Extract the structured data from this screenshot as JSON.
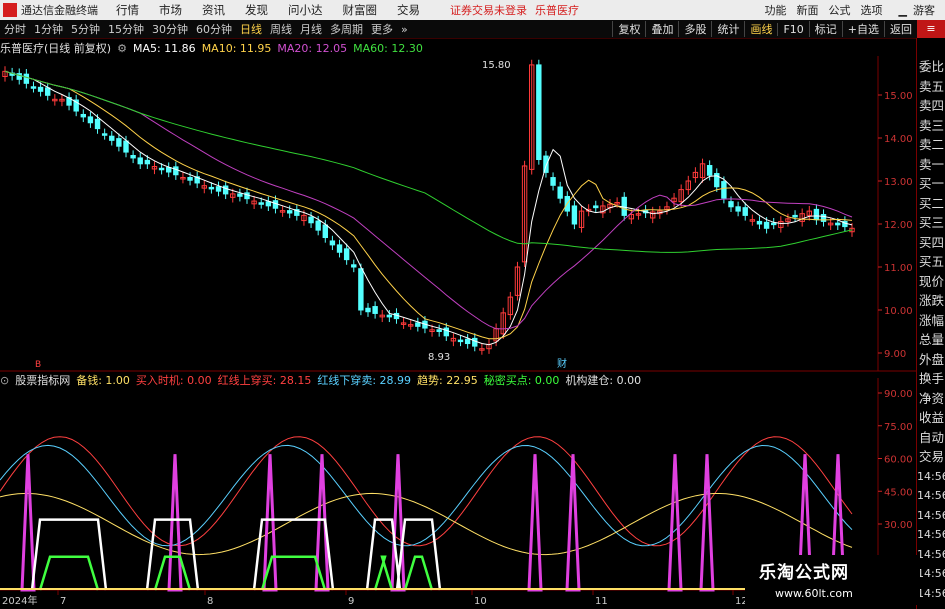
{
  "app_title": "通达信金融终端",
  "menus": [
    "行情",
    "市场",
    "资讯",
    "发现",
    "问小达",
    "财富圈",
    "交易"
  ],
  "login_warning": "证券交易未登录",
  "stock_name_top": "乐普医疗",
  "right_menus": [
    "功能",
    "新面",
    "公式",
    "选项"
  ],
  "guest": "游客",
  "periods": [
    "分时",
    "1分钟",
    "5分钟",
    "15分钟",
    "30分钟",
    "60分钟",
    "日线",
    "周线",
    "月线",
    "多周期",
    "更多"
  ],
  "selected_period": "日线",
  "tools": [
    "复权",
    "叠加",
    "多股",
    "统计",
    "画线",
    "F10",
    "标记",
    "+自选",
    "返回"
  ],
  "selected_tool": "画线",
  "info": {
    "title": "乐普医疗(日线 前复权)",
    "ma5": "MA5: 11.86",
    "ma10": "MA10: 11.95",
    "ma20": "MA20: 12.05",
    "ma60": "MA60: 12.30"
  },
  "price_axis": [
    "15.00",
    "14.00",
    "13.00",
    "12.00",
    "11.00",
    "10.00",
    "9.00"
  ],
  "annotations": {
    "high": "15.80",
    "low": "8.93"
  },
  "sidebar": [
    "委比",
    "卖五",
    "卖四",
    "卖三",
    "卖二",
    "卖一",
    "买一",
    "买二",
    "买三",
    "买四",
    "买五",
    "现价",
    "涨跌",
    "涨幅",
    "总量",
    "外盘",
    "换手",
    "净资",
    "收益",
    "自动",
    "交易",
    "14:56",
    "14:56",
    "14:56",
    "14:56",
    "14:56",
    "14:56",
    "14:56"
  ],
  "sidebar_icon": "L",
  "indicator": {
    "name": "股票指标网",
    "items": [
      {
        "label": "备钱: 1.00",
        "color": "#ffe066"
      },
      {
        "label": "买入时机: 0.00",
        "color": "#ff4040"
      },
      {
        "label": "红线上穿买: 28.15",
        "color": "#ff4040"
      },
      {
        "label": "红线下穿卖: 28.99",
        "color": "#5ad0ff"
      },
      {
        "label": "趋势: 22.95",
        "color": "#ffe066"
      },
      {
        "label": "秘密买点: 0.00",
        "color": "#3cff3c"
      },
      {
        "label": "机构建仓: 0.00",
        "color": "#e0e0e0"
      }
    ]
  },
  "ind_axis": [
    "90.00",
    "75.00",
    "60.00",
    "45.00",
    "30.00"
  ],
  "date_axis": {
    "year": "2024年",
    "labels": [
      "7",
      "8",
      "9",
      "10",
      "11",
      "12"
    ]
  },
  "markers": {
    "m1": "B",
    "m2": "财"
  },
  "watermark": {
    "title": "乐淘公式网",
    "url": "www.60lt.com"
  },
  "colors": {
    "up": "#ff3b3b",
    "down": "#54ffff",
    "ma5": "#ffffff",
    "ma10": "#ffd24a",
    "ma20": "#c040c0",
    "ma60": "#30d030"
  }
}
